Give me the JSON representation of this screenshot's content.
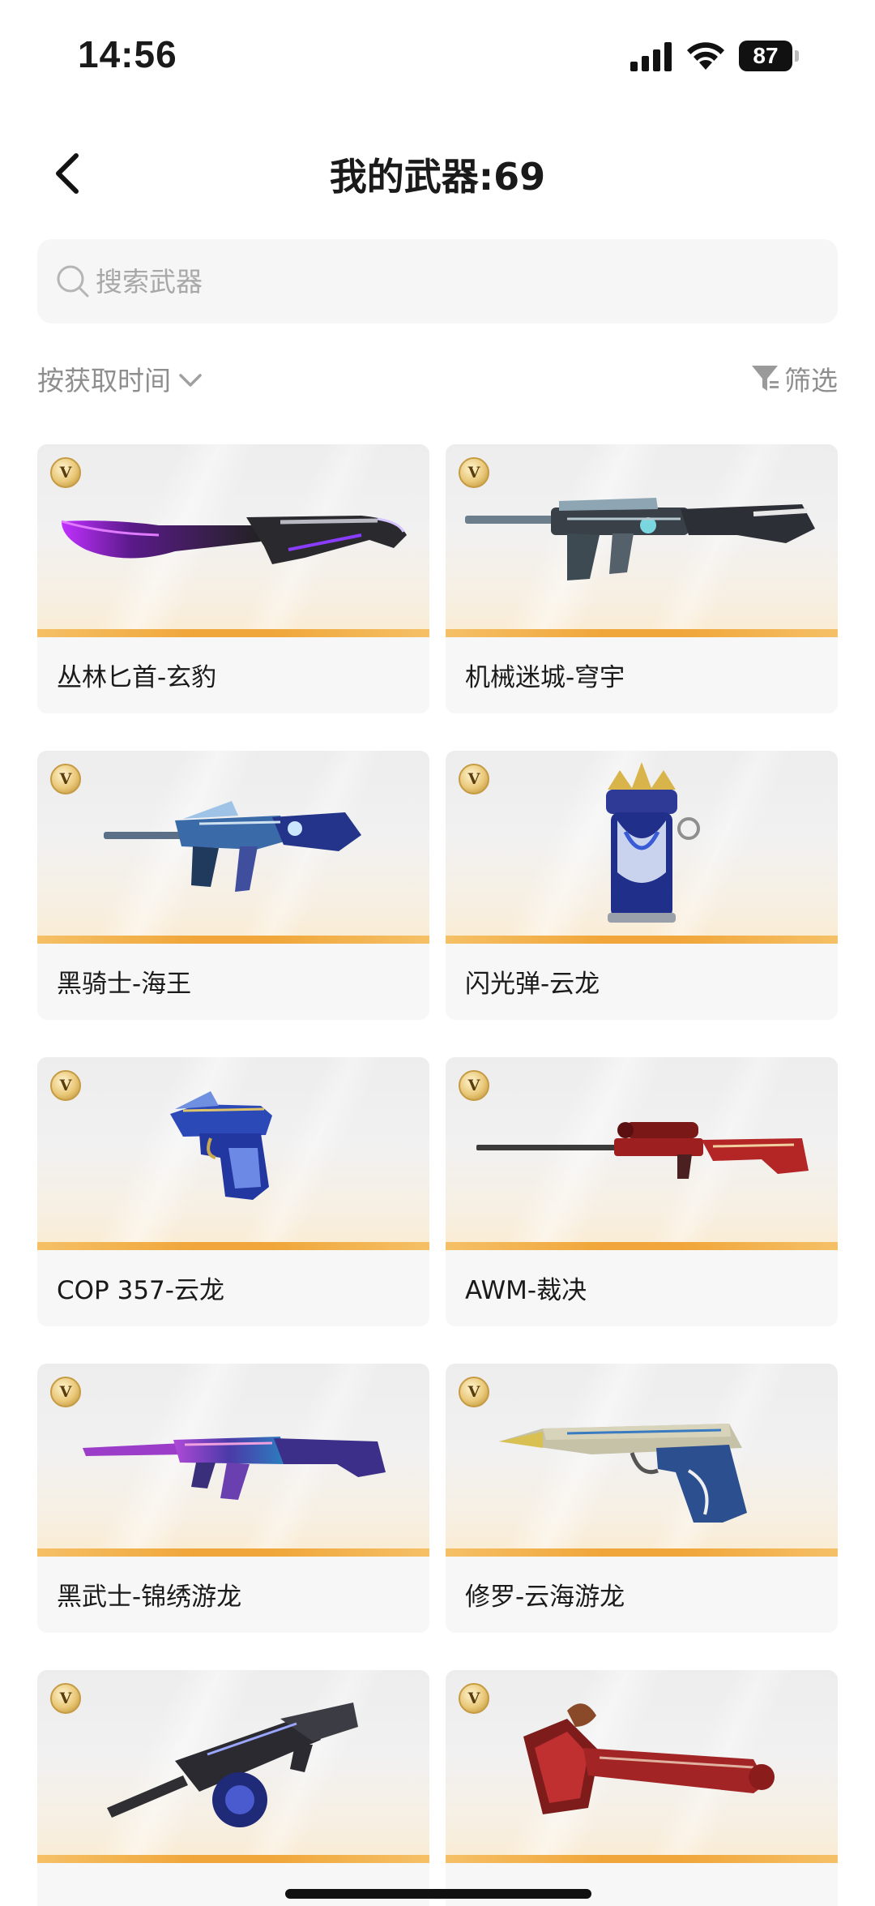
{
  "status_bar": {
    "time": "14:56",
    "battery_level": "87"
  },
  "header": {
    "title": "我的武器:69"
  },
  "search": {
    "placeholder": "搜索武器",
    "value": ""
  },
  "sort": {
    "label": "按获取时间"
  },
  "filter": {
    "label": "筛选"
  },
  "badge_label": "V",
  "colors": {
    "accent_bar": "#f0a63a",
    "badge_gold": "#e9c777",
    "muted_text": "#8e8e8e",
    "card_bg": "#f7f7f7"
  },
  "weapons": [
    {
      "name": "丛林匕首-玄豹",
      "icon": "knife-icon"
    },
    {
      "name": "机械迷城-穹宇",
      "icon": "rifle-icon"
    },
    {
      "name": "黑骑士-海王",
      "icon": "rifle-icon"
    },
    {
      "name": "闪光弹-云龙",
      "icon": "flashbang-icon"
    },
    {
      "name": "COP 357-云龙",
      "icon": "pistol-icon"
    },
    {
      "name": "AWM-裁决",
      "icon": "sniper-rifle-icon"
    },
    {
      "name": "黑武士-锦绣游龙",
      "icon": "rifle-icon"
    },
    {
      "name": "修罗-云海游龙",
      "icon": "pistol-icon"
    },
    {
      "name": "",
      "icon": "machine-gun-icon"
    },
    {
      "name": "",
      "icon": "axe-icon"
    }
  ]
}
